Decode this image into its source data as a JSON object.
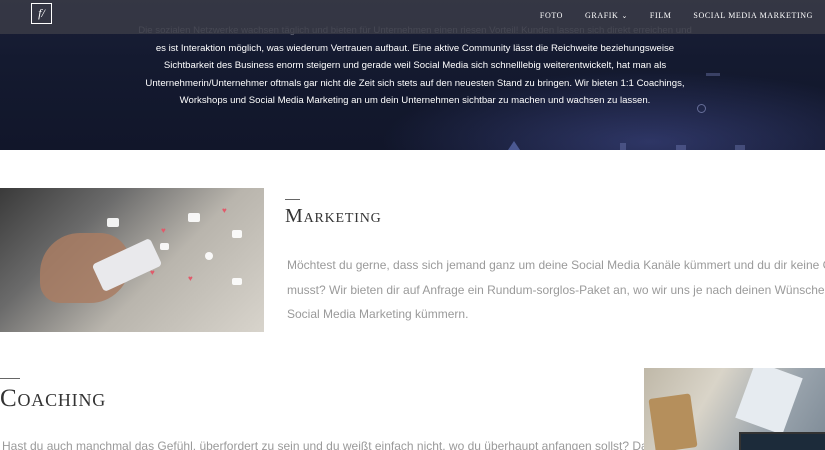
{
  "nav": {
    "logo_glyph": "f/",
    "items": [
      {
        "label": "Foto",
        "has_dropdown": false
      },
      {
        "label": "Grafik",
        "has_dropdown": true
      },
      {
        "label": "Film",
        "has_dropdown": false
      },
      {
        "label": "Social Media Marketing",
        "has_dropdown": false
      }
    ]
  },
  "hero": {
    "lines": [
      "Die sozialen Netzwerke wachsen täglich und bieten für Unternehmen einen riesen Vorteil! Kunden lassen sich direkt erreichen und",
      "es ist Interaktion möglich, was wiederum Vertrauen aufbaut. Eine aktive Community lässt die Reichweite beziehungsweise",
      "Sichtbarkeit des Business enorm steigern und gerade weil Social Media sich schnelllebig weiterentwickelt, hat man als",
      "Unternehmerin/Unternehmer oftmals gar nicht die Zeit sich stets auf den neuesten Stand zu bringen. Wir bieten 1:1 Coachings,",
      "Workshops und Social Media Marketing an um dein Unternehmen sichtbar zu machen und wachsen zu lassen."
    ]
  },
  "marketing": {
    "title": "Marketing",
    "lines": [
      "Möchtest du gerne, dass sich jemand ganz um deine Social Media Kanäle kümmert und du dir keine Gedanl",
      "musst? Wir bieten dir auf Anfrage ein Rundum-sorglos-Paket an, wo wir uns je nach deinen Wünschen, küm",
      "Social Media Marketing kümmern."
    ]
  },
  "coaching": {
    "title": "Coaching",
    "lines": [
      "Hast du auch manchmal das Gefühl, überfordert zu sein und du weißt einfach nicht, wo du überhaupt anfangen sollst? Das"
    ]
  },
  "colors": {
    "hero_bg": "#141a30",
    "topbar_bg": "#3c3e48",
    "body_text": "#9a9a9a",
    "title_text": "#333333"
  }
}
